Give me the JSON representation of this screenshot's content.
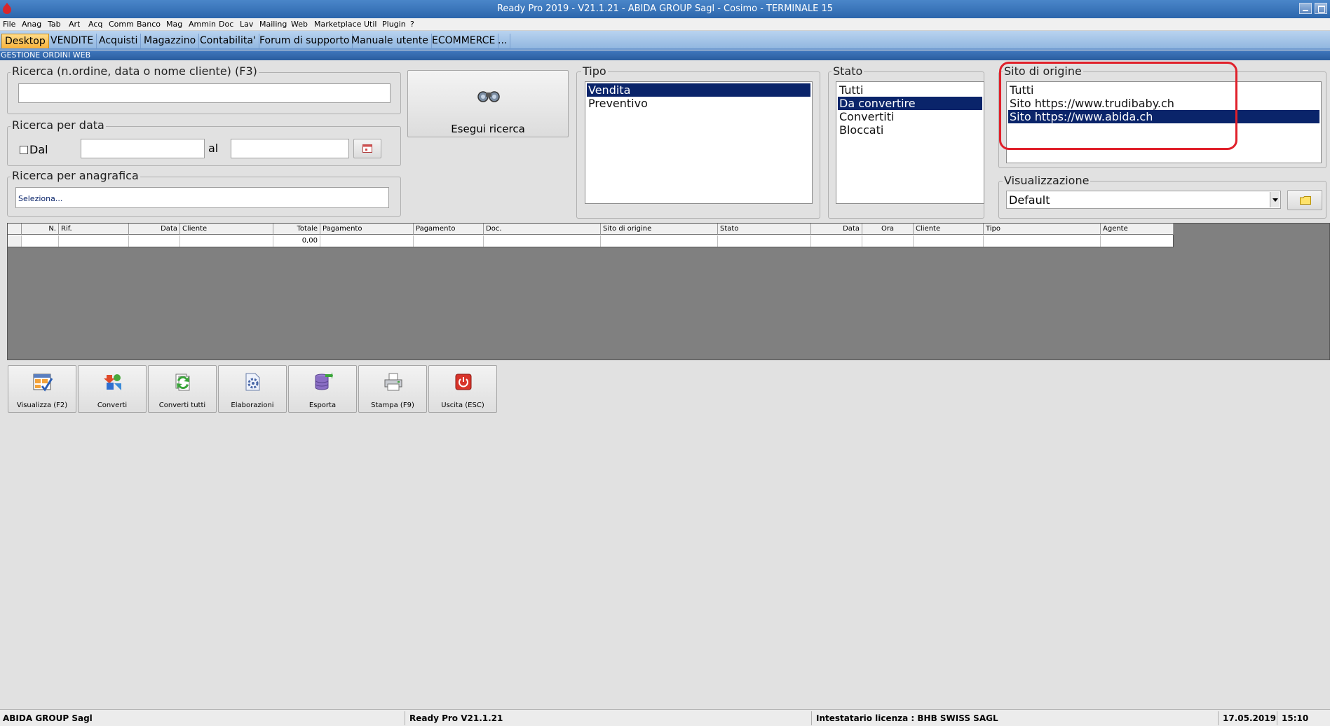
{
  "window": {
    "title": "Ready Pro 2019 - V21.1.21 - ABIDA GROUP Sagl - Cosimo - TERMINALE 15"
  },
  "menu": [
    "File",
    "Anag",
    "Tab",
    "Art",
    "Acq",
    "Comm",
    "Banco",
    "Mag",
    "Ammin",
    "Doc",
    "Lav",
    "Mailing",
    "Web",
    "Marketplace",
    "Util",
    "Plugin",
    "?"
  ],
  "tabs": [
    "Desktop",
    "VENDITE",
    "Acquisti",
    "Magazzino",
    "Contabilita'",
    "Forum di supporto",
    "Manuale utente",
    "ECOMMERCE",
    "..."
  ],
  "section_title": "GESTIONE ORDINI WEB",
  "search": {
    "label": "Ricerca (n.ordine, data o nome cliente) (F3)",
    "value": ""
  },
  "date_search": {
    "label": "Ricerca per data",
    "from_label": "Dal",
    "to_label": "al",
    "from_value": "",
    "to_value": ""
  },
  "registry_search": {
    "label": "Ricerca per anagrafica",
    "placeholder": "Seleziona..."
  },
  "search_button": {
    "label": "Esegui ricerca"
  },
  "tipo": {
    "label": "Tipo",
    "items": [
      "Vendita",
      "Preventivo"
    ],
    "selected": 0
  },
  "stato": {
    "label": "Stato",
    "items": [
      "Tutti",
      "Da convertire",
      "Convertiti",
      "Bloccati"
    ],
    "selected": 1
  },
  "origin": {
    "label": "Sito di origine",
    "items": [
      "Tutti",
      "Sito https://www.trudibaby.ch",
      "Sito https://www.abida.ch"
    ],
    "selected": 2
  },
  "view": {
    "label": "Visualizzazione",
    "value": "Default"
  },
  "grid": {
    "columns": [
      "",
      "N.",
      "Rif.",
      "Data",
      "Cliente",
      "Totale",
      "Pagamento",
      "Pagamento",
      "Doc.",
      "Sito di origine",
      "Stato",
      "Data",
      "Ora",
      "Cliente",
      "Tipo",
      "Agente"
    ],
    "row": {
      "totale": "0,00"
    }
  },
  "toolbar": [
    "Visualizza (F2)",
    "Converti",
    "Converti tutti",
    "Elaborazioni",
    "Esporta",
    "Stampa (F9)",
    "Uscita (ESC)"
  ],
  "status": {
    "company": "ABIDA GROUP Sagl",
    "version": "Ready Pro V21.1.21",
    "license": "Intestatario licenza : BHB SWISS SAGL",
    "date": "17.05.2019",
    "time": "15:10"
  },
  "colors": {
    "highlight": "#e0202a",
    "selection": "#0a246a",
    "active_tab": "#f7b23b"
  }
}
